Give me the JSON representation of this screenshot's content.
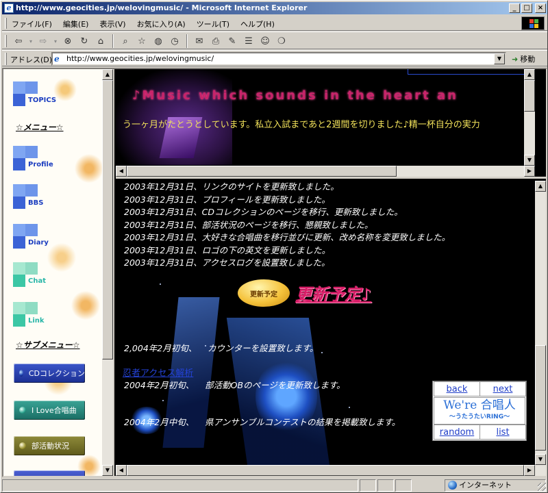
{
  "window": {
    "title": "http://www.geocities.jp/welovingmusic/ - Microsoft Internet Explorer",
    "min": "_",
    "max": "□",
    "close": "×"
  },
  "menubar": [
    "ファイル(F)",
    "編集(E)",
    "表示(V)",
    "お気に入り(A)",
    "ツール(T)",
    "ヘルプ(H)"
  ],
  "address": {
    "label": "アドレス(D)",
    "url": "http://www.geocities.jp/welovingmusic/",
    "go_label": "移動"
  },
  "sidebar": {
    "items": [
      {
        "label": "TOPICS"
      },
      {
        "label": "Profile"
      },
      {
        "label": "BBS"
      },
      {
        "label": "Diary"
      },
      {
        "label": "Chat"
      },
      {
        "label": "Link"
      }
    ],
    "menu_heading": "☆メニュー☆",
    "submenu_heading": "☆サブメニュー☆",
    "buttons": [
      {
        "label": "CDコレクション"
      },
      {
        "label": "I Love合唱曲"
      },
      {
        "label": "部活動状況"
      }
    ]
  },
  "top_frame": {
    "marquee_title": "♪Music which sounds in  the heart an",
    "marquee_text": "う一ヶ月がたとうとしています。私立入試まであと2週間を切りました♪精一杯自分の実力"
  },
  "main": {
    "news": [
      "2003年12月31日、リンクのサイトを更新致しました。",
      "2003年12月31日、プロフィールを更新致しました。",
      "2003年12月31日、CDコレクションのページを移行、更新致しました。",
      "2003年12月31日、部活状況のページを移行、懇親致しました。",
      "2003年12月31日、大好きな合唱曲を移行並びに更新、改め名称を変更致しました。",
      "2003年12月31日、ロゴの下の英文を更新しました。",
      "2003年12月31日、アクセスログを設置致しました。"
    ],
    "update_button": "更新予定",
    "update_title": "更新予定♪",
    "planned": [
      "2,004年2月初旬、    カウンターを設置致します。",
      "2004年2月初旬、    部活動OBのページを更新致します。",
      "2004年2月中旬、    県アンサンブルコンテストの結果を掲載致します。"
    ],
    "ninja_link": "忍者アクセス解析",
    "ring": {
      "back": "back",
      "next": "next",
      "logo_main": "We're 合唱人",
      "logo_sub": "〜うたうたいRING〜",
      "random": "random",
      "list": "list"
    }
  },
  "status": {
    "zone": "インターネット"
  },
  "colors": {
    "titlebar_start": "#0a246a",
    "titlebar_end": "#a6caf0",
    "marquee_pink": "#c8246a",
    "marquee_yellow": "#f1e15a",
    "update_title": "#d81e68",
    "link_blue": "#2442d6"
  }
}
